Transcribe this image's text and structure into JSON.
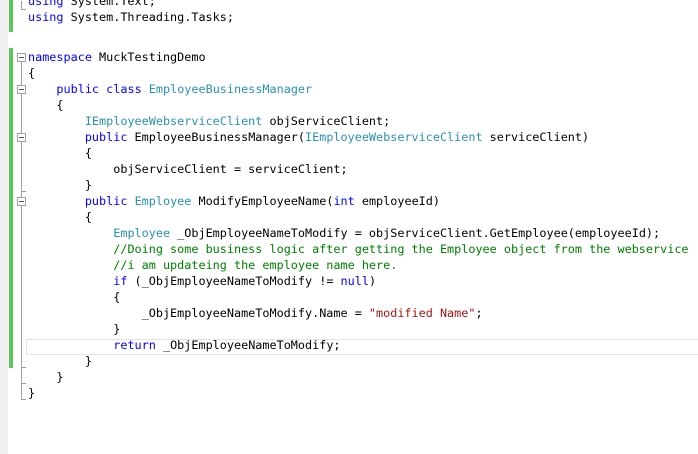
{
  "code": {
    "l1": [
      "using",
      " System.Text;"
    ],
    "l2": [
      "using",
      " System.Threading.Tasks;"
    ],
    "l4": [
      "namespace",
      " MuckTestingDemo"
    ],
    "l5": [
      "{"
    ],
    "l6": [
      "    ",
      "public",
      " ",
      "class",
      " ",
      "EmployeeBusinessManager"
    ],
    "l7": [
      "    {"
    ],
    "l8": [
      "        ",
      "IEmployeeWebserviceClient",
      " objServiceClient;"
    ],
    "l9": [
      "        ",
      "public",
      " EmployeeBusinessManager(",
      "IEmployeeWebserviceClient",
      " serviceClient)"
    ],
    "l10": [
      "        {"
    ],
    "l11": [
      "            objServiceClient = serviceClient;"
    ],
    "l12": [
      "        }"
    ],
    "l13": [
      "        ",
      "public",
      " ",
      "Employee",
      " ModifyEmployeeName(",
      "int",
      " employeeId)"
    ],
    "l14": [
      "        {"
    ],
    "l15": [
      "            ",
      "Employee",
      " _ObjEmployeeNameToModify = objServiceClient.GetEmployee(employeeId);"
    ],
    "l16": [
      "            ",
      "//Doing some business logic after getting the Employee object from the webservice"
    ],
    "l17": [
      "            ",
      "//i am updateing the employee name here."
    ],
    "l18": [
      "            ",
      "if",
      " (_ObjEmployeeNameToModify != ",
      "null",
      ")"
    ],
    "l19": [
      "            {"
    ],
    "l20": [
      "                _ObjEmployeeNameToModify.Name = ",
      "\"modified Name\"",
      ";"
    ],
    "l21": [
      "            }"
    ],
    "l22": [
      "            ",
      "return",
      " _ObjEmployeeNameToModify;"
    ],
    "l23": [
      "        }"
    ],
    "l24": [
      "    }"
    ],
    "l25": [
      "}"
    ]
  }
}
